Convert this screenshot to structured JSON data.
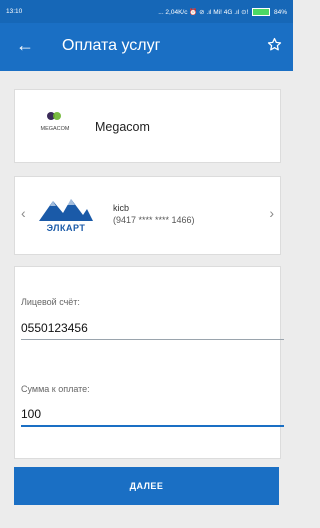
{
  "status_bar": {
    "time": "13:10",
    "indicators": "... 2,04K/c ⏰ ⊘ .ıl Mi! 4G .ıl ⊙!",
    "battery": "84%"
  },
  "app_bar": {
    "title": "Оплата услуг",
    "back_icon": "arrow-left-icon",
    "favorite_icon": "star-outline-icon"
  },
  "provider": {
    "logo_text": "MEGACOM",
    "name": "Megacom"
  },
  "card": {
    "brand": "ЭЛКАРТ",
    "bank": "kicb",
    "number": "(9417 **** **** 1466)"
  },
  "form": {
    "account_label": "Лицевой счёт:",
    "account_value": "0550123456",
    "amount_label": "Сумма к оплате:",
    "amount_value": "100"
  },
  "actions": {
    "next_label": "ДАЛЕЕ"
  },
  "colors": {
    "primary": "#1a6fc4",
    "background": "#ececec"
  }
}
